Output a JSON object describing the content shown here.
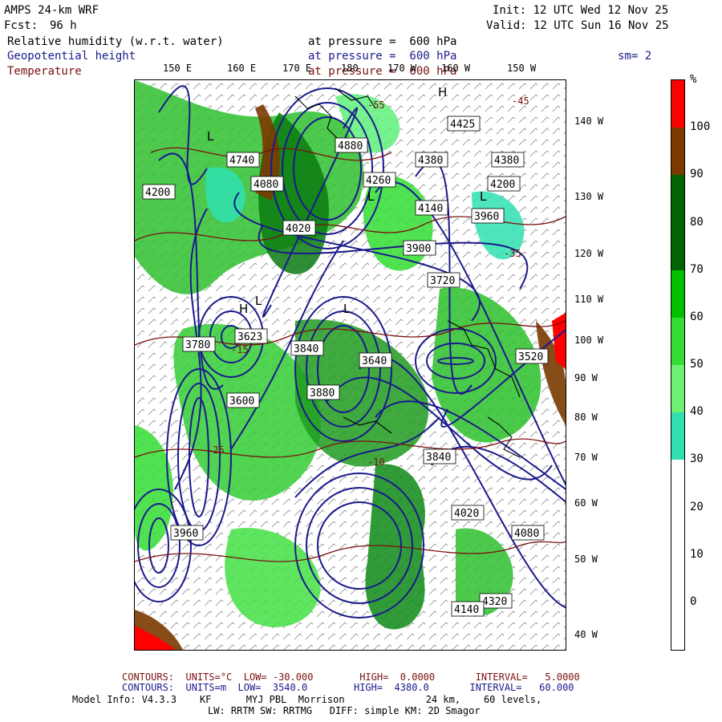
{
  "header": {
    "model": "AMPS 24-km WRF",
    "init": "Init: 12 UTC Wed 12 Nov 25",
    "fcst_label": "Fcst:",
    "fcst_value": "96 h",
    "valid": "Valid: 12 UTC Sun 16 Nov 25",
    "fields": [
      {
        "name": "Relative humidity (w.r.t. water)",
        "level": "at pressure =  600 hPa",
        "color": "#000000"
      },
      {
        "name": "Geopotential height",
        "level": "at pressure =  600 hPa",
        "color": "#1a1a8c"
      },
      {
        "name": "Temperature",
        "level": "at pressure =  600 hPa",
        "color": "#7a1010"
      }
    ],
    "smoothing": "sm= 2"
  },
  "map": {
    "longitude_labels": [
      "150 E",
      "160 E",
      "170 E",
      "180",
      "170 W",
      "160 W",
      "150 W"
    ],
    "latitude_labels": [
      "140 W",
      "130 W",
      "120 W",
      "110 W",
      "100 W",
      "90 W",
      "80 W",
      "70 W",
      "60 W",
      "50 W",
      "40 W"
    ],
    "height_labels": [
      "4880",
      "4740",
      "4260",
      "4380",
      "4425",
      "4200",
      "4080",
      "4020",
      "4140",
      "3960",
      "3900",
      "3720",
      "3780",
      "3840",
      "3600",
      "3623",
      "3640",
      "3520",
      "3880",
      "3840",
      "4320",
      "4380",
      "4200",
      "4140",
      "4020",
      "4080",
      "3960"
    ],
    "high_low_markers": [
      "H",
      "L",
      "L",
      "L",
      "L",
      "H",
      "L"
    ],
    "temperature_labels": [
      "-55",
      "-45",
      "-35",
      "-25",
      "-15",
      "-10"
    ],
    "colors": {
      "height_contour": "#1a1a8c",
      "temperature_contour": "#7a1010",
      "coastline": "#000000"
    }
  },
  "colorbar": {
    "unit": "%",
    "labels": [
      "100",
      "90",
      "80",
      "70",
      "60",
      "50",
      "40",
      "30",
      "20",
      "10",
      "0"
    ],
    "bands": [
      {
        "color": "#ff0000"
      },
      {
        "color": "#7a3a00"
      },
      {
        "color": "#006400"
      },
      {
        "color": "#006400"
      },
      {
        "color": "#00c000"
      },
      {
        "color": "#33dd33"
      },
      {
        "color": "#70f070"
      },
      {
        "color": "#30e0b0"
      },
      {
        "color": "#ffffff"
      },
      {
        "color": "#ffffff"
      },
      {
        "color": "#ffffff"
      },
      {
        "color": "#ffffff"
      }
    ]
  },
  "footer": {
    "temp_contours": "CONTOURS:  UNITS=°C  LOW= -30.000        HIGH=  0.0000       INTERVAL=   5.0000",
    "height_contours": "CONTOURS:  UNITS=m  LOW=  3540.0        HIGH=  4380.0       INTERVAL=   60.000",
    "model_info": "Model Info: V4.3.3    KF      MYJ PBL  Morrison              24 km,    60 levels,",
    "physics": "LW: RRTM SW: RRTMG   DIFF: simple KM: 2D Smagor"
  }
}
